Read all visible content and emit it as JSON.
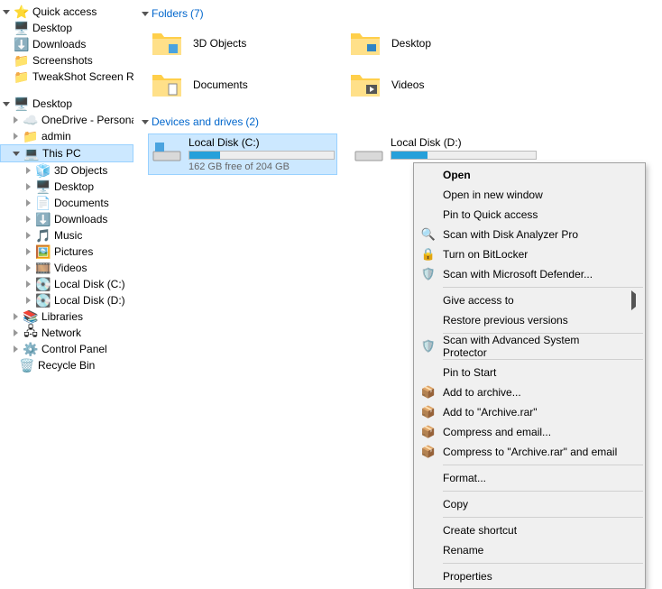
{
  "nav": {
    "quick": "Quick access",
    "q_desktop": "Desktop",
    "q_downloads": "Downloads",
    "q_screenshots": "Screenshots",
    "q_tweakshot": "TweakShot Screen Reco",
    "desktop": "Desktop",
    "onedrive": "OneDrive - Personal",
    "admin": "admin",
    "thispc": "This PC",
    "p_3d": "3D Objects",
    "p_desktop": "Desktop",
    "p_documents": "Documents",
    "p_downloads": "Downloads",
    "p_music": "Music",
    "p_pictures": "Pictures",
    "p_videos": "Videos",
    "p_ldc": "Local Disk (C:)",
    "p_ldd": "Local Disk (D:)",
    "libraries": "Libraries",
    "network": "Network",
    "cpanel": "Control Panel",
    "recycle": "Recycle Bin"
  },
  "sections": {
    "folders_label": "Folders",
    "folders_count": "(7)",
    "drives_label": "Devices and drives",
    "drives_count": "(2)"
  },
  "folders": {
    "f0": "3D Objects",
    "f1": "Desktop",
    "f2": "Documents",
    "f3": "Videos"
  },
  "drives": {
    "c_name": "Local Disk (C:)",
    "c_free": "162 GB free of 204 GB",
    "c_fill_pct": "21%",
    "d_name": "Local Disk (D:)",
    "d_fill_pct": "25%"
  },
  "ctx": {
    "open": "Open",
    "open_new": "Open in new window",
    "pin_qa": "Pin to Quick access",
    "dap": "Scan with Disk Analyzer Pro",
    "bitlocker": "Turn on BitLocker",
    "defender": "Scan with Microsoft Defender...",
    "give_access": "Give access to",
    "restore": "Restore previous versions",
    "asp": "Scan with Advanced System Protector",
    "pin_start": "Pin to Start",
    "add_arch": "Add to archive...",
    "add_arch_rar": "Add to \"Archive.rar\"",
    "comp_email": "Compress and email...",
    "comp_rar_email": "Compress to \"Archive.rar\" and email",
    "format": "Format...",
    "copy": "Copy",
    "shortcut": "Create shortcut",
    "rename": "Rename",
    "properties": "Properties"
  }
}
